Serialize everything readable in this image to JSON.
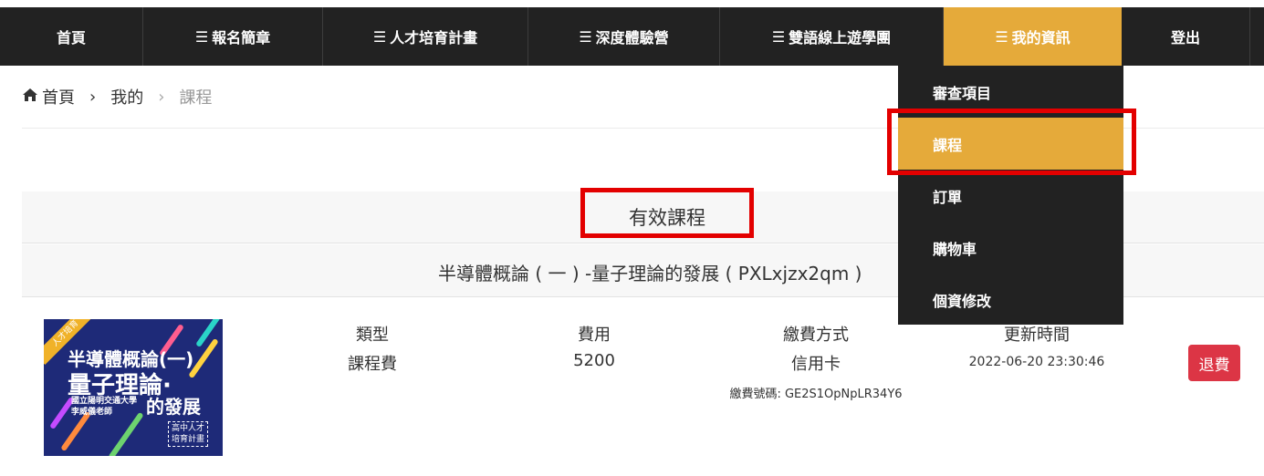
{
  "nav": {
    "items": [
      {
        "label": "首頁",
        "has_menu_icon": false
      },
      {
        "label": "報名簡章",
        "has_menu_icon": true
      },
      {
        "label": "人才培育計畫",
        "has_menu_icon": true
      },
      {
        "label": "深度體驗營",
        "has_menu_icon": true
      },
      {
        "label": "雙語線上遊學團",
        "has_menu_icon": true
      },
      {
        "label": "我的資訊",
        "has_menu_icon": true,
        "active": true
      },
      {
        "label": "登出",
        "has_menu_icon": false
      }
    ],
    "menu_glyph": "☰",
    "active_color": "#e5aa3a",
    "bg_color": "#222222"
  },
  "breadcrumb": {
    "home_icon": "home-icon",
    "items": [
      "首頁",
      "我的",
      "課程"
    ],
    "separator": "›"
  },
  "dropdown": {
    "items": [
      {
        "label": "審查項目"
      },
      {
        "label": "課程",
        "active": true
      },
      {
        "label": "訂單"
      },
      {
        "label": "購物車"
      },
      {
        "label": "個資修改"
      }
    ]
  },
  "section": {
    "title": "有效課程"
  },
  "course": {
    "name": "半導體概論 ( 一 ) -量子理論的發展 ( PXLxjzx2qm )",
    "thumbnail": {
      "ribbon": "人才培育",
      "line1": "半導體概論(一)",
      "line2": "量子理論·",
      "line3": "國立陽明交通大學\n李威儀老師",
      "line4": "的發展",
      "badge": "高中人才\n培育計畫"
    },
    "type_label": "類型",
    "type_value": "課程費",
    "fee_label": "費用",
    "fee_value": "5200",
    "payment_label": "繳費方式",
    "payment_value": "信用卡",
    "payment_code": "繳費號碼: GE2S1OpNpLR34Y6",
    "updated_label": "更新時間",
    "updated_value": "2022-06-20 23:30:46",
    "refund_label": "退費"
  },
  "colors": {
    "accent": "#e5aa3a",
    "highlight_box": "#e30000",
    "refund_button": "#dc3545"
  }
}
